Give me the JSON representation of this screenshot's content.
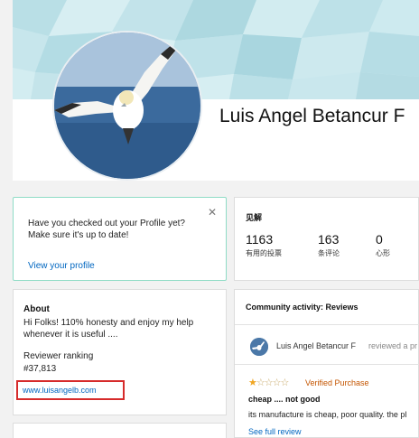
{
  "profile": {
    "name": "Luis Angel Betancur F"
  },
  "notice": {
    "text": "Have you checked out your Profile yet? Make sure it's up to date!",
    "close_icon": "close-icon",
    "link": "View your profile"
  },
  "stats": {
    "title": "见解",
    "items": [
      {
        "value": "1163",
        "label": "有用的投票"
      },
      {
        "value": "163",
        "label": "条评论"
      },
      {
        "value": "0",
        "label": "心形"
      }
    ]
  },
  "about": {
    "title": "About",
    "text": "Hi Folks! 110% honesty and enjoy my help whenever it is useful ....",
    "ranking_label": "Reviewer ranking",
    "ranking_value": "#37,813",
    "website": "www.luisangelb.com"
  },
  "community": {
    "title": "Community activity: Reviews",
    "review": {
      "author": "Luis Angel Betancur F",
      "action": "reviewed a pr",
      "rating": 1,
      "max_rating": 5,
      "verified": "Verified Purchase",
      "title": "cheap .... not good",
      "body": "its manufacture is cheap, poor quality. the pl",
      "link": "See full review"
    }
  },
  "colors": {
    "link": "#0066c0",
    "highlight_box": "#d62b2b",
    "verified": "#c45500",
    "star": "#f0a623",
    "notice_border": "#8fdcc6"
  }
}
